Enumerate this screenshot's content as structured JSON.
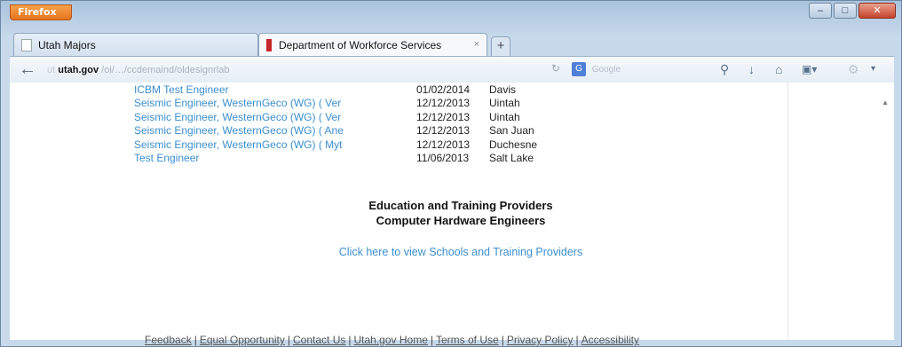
{
  "browser": {
    "menu_button": "Firefox",
    "controls": {
      "minimize": "–",
      "maximize": "□",
      "close": "✕"
    },
    "tabs": [
      {
        "label": "Utah Majors"
      },
      {
        "label": "Department of Workforce Services",
        "close": "×"
      }
    ],
    "new_tab": "+",
    "url": {
      "prefix": "ut ",
      "domain": "utah.gov",
      "path": "/oi/…/ccdemaind/oldesignrlab"
    },
    "search_placeholder": "Google",
    "search_engine_icon": "G"
  },
  "jobs": [
    {
      "title": "ICBM Test Engineer",
      "date": "01/02/2014",
      "location": "Davis"
    },
    {
      "title": "Seismic Engineer, WesternGeco (WG) ( Ver",
      "date": "12/12/2013",
      "location": "Uintah"
    },
    {
      "title": "Seismic Engineer, WesternGeco (WG) ( Ver",
      "date": "12/12/2013",
      "location": "Uintah"
    },
    {
      "title": "Seismic Engineer, WesternGeco (WG) ( Ane",
      "date": "12/12/2013",
      "location": "San Juan"
    },
    {
      "title": "Seismic Engineer, WesternGeco (WG) ( Myt",
      "date": "12/12/2013",
      "location": "Duchesne"
    },
    {
      "title": "Test Engineer",
      "date": "11/06/2013",
      "location": "Salt Lake"
    }
  ],
  "section": {
    "heading": "Education and Training Providers",
    "subheading": "Computer Hardware Engineers",
    "link": "Click here to view Schools and Training Providers"
  },
  "footer": {
    "separator": "|",
    "links": [
      "Feedback",
      "Equal Opportunity",
      "Contact Us",
      "Utah.gov Home",
      "Terms of Use",
      "Privacy Policy",
      "Accessibility"
    ]
  }
}
